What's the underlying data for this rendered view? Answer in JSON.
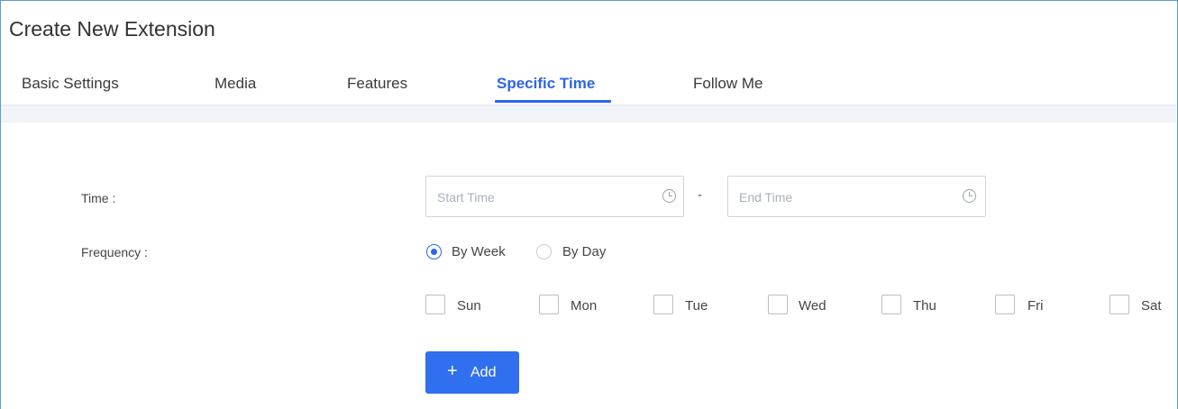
{
  "page": {
    "title": "Create New Extension"
  },
  "tabs": [
    {
      "label": "Basic Settings",
      "active": false
    },
    {
      "label": "Media",
      "active": false
    },
    {
      "label": "Features",
      "active": false
    },
    {
      "label": "Specific Time",
      "active": true
    },
    {
      "label": "Follow Me",
      "active": false
    }
  ],
  "form": {
    "time_label": "Time :",
    "start_time": {
      "value": "",
      "placeholder": "Start Time",
      "icon": "clock-icon"
    },
    "separator": "-",
    "end_time": {
      "value": "",
      "placeholder": "End Time",
      "icon": "clock-icon"
    },
    "frequency_label": "Frequency :",
    "frequency_options": [
      {
        "label": "By Week",
        "checked": true
      },
      {
        "label": "By Day",
        "checked": false
      }
    ],
    "days": [
      {
        "label": "Sun",
        "checked": false
      },
      {
        "label": "Mon",
        "checked": false
      },
      {
        "label": "Tue",
        "checked": false
      },
      {
        "label": "Wed",
        "checked": false
      },
      {
        "label": "Thu",
        "checked": false
      },
      {
        "label": "Fri",
        "checked": false
      },
      {
        "label": "Sat",
        "checked": false
      }
    ],
    "add_button": {
      "icon": "+",
      "label": "Add"
    }
  },
  "colors": {
    "accent": "#2e64e8",
    "button": "#2f6ff0",
    "frame_border": "#5b9bd5",
    "band": "#f1f4f9"
  }
}
